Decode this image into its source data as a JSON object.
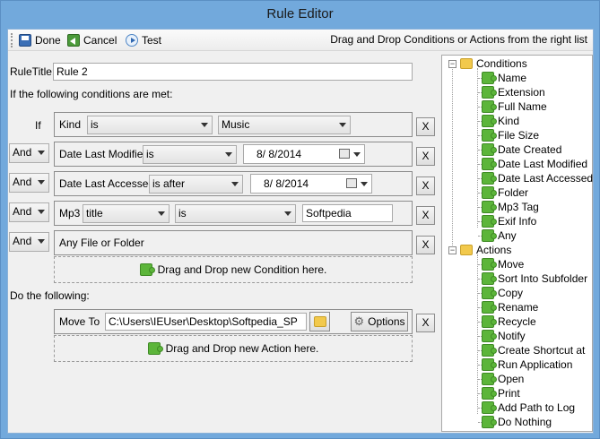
{
  "window": {
    "title": "Rule Editor"
  },
  "toolbar": {
    "done_label": "Done",
    "cancel_label": "Cancel",
    "test_label": "Test",
    "hint": "Drag and Drop Conditions or Actions from the right list"
  },
  "rule": {
    "title_label": "RuleTitle:",
    "title_value": "Rule 2",
    "conditions_heading": "If the following conditions are met:",
    "actions_heading": "Do the following:"
  },
  "conditions": [
    {
      "prefix": "If",
      "field": "Kind",
      "op": "is",
      "value": "Music",
      "remove": "X"
    },
    {
      "prefix": "And",
      "field": "Date Last Modified",
      "op": "is",
      "value": "8/  8/2014",
      "remove": "X"
    },
    {
      "prefix": "And",
      "field": "Date Last Accessed",
      "op": "is after",
      "value": "8/  8/2014",
      "remove": "X"
    },
    {
      "prefix": "And",
      "field": "Mp3",
      "sub": "title",
      "op": "is",
      "value": "Softpedia",
      "remove": "X"
    },
    {
      "prefix": "And",
      "field": "Any File or Folder",
      "remove": "X"
    }
  ],
  "drop_condition": "Drag and Drop new Condition here.",
  "action": {
    "label": "Move To",
    "path": "C:\\Users\\IEUser\\Desktop\\Softpedia_SP",
    "options_label": "Options",
    "remove": "X"
  },
  "drop_action": "Drag and Drop new Action here.",
  "tree": {
    "conditions_label": "Conditions",
    "conditions": [
      "Name",
      "Extension",
      "Full Name",
      "Kind",
      "File Size",
      "Date Created",
      "Date Last Modified",
      "Date Last Accessed",
      "Folder",
      "Mp3 Tag",
      "Exif Info",
      "Any"
    ],
    "actions_label": "Actions",
    "actions": [
      "Move",
      "Sort Into Subfolder",
      "Copy",
      "Rename",
      "Recycle",
      "Notify",
      "Create Shortcut at",
      "Run Application",
      "Open",
      "Print",
      "Add Path to Log",
      "Do Nothing"
    ]
  }
}
